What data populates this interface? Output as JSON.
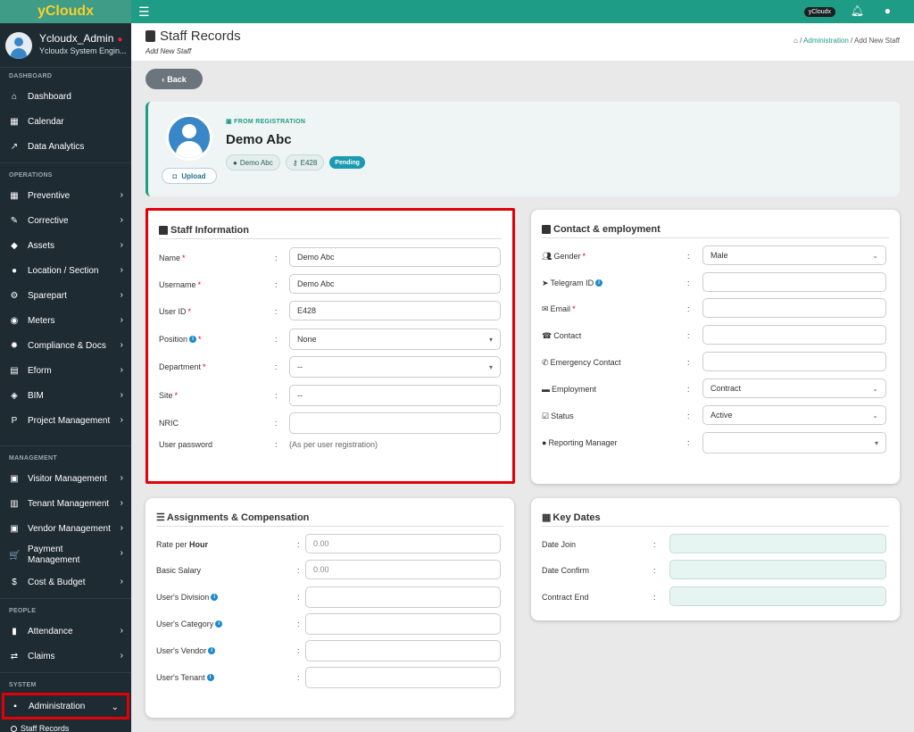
{
  "app": {
    "brand": "yCloudx"
  },
  "user": {
    "name": "Ycloudx_Admin",
    "role": "Ycloudx System Engin..."
  },
  "sidebar": {
    "sections": [
      "DASHBOARD",
      "OPERATIONS",
      "MANAGEMENT",
      "PEOPLE",
      "SYSTEM"
    ],
    "dashboard": [
      "Dashboard",
      "Calendar",
      "Data Analytics"
    ],
    "operations": [
      "Preventive",
      "Corrective",
      "Assets",
      "Location / Section",
      "Sparepart",
      "Meters",
      "Compliance & Docs",
      "Eform",
      "BIM",
      "Project Management"
    ],
    "management": [
      "Visitor Management",
      "Tenant Management",
      "Vendor Management",
      "Payment Management",
      "Cost & Budget"
    ],
    "people": [
      "Attendance",
      "Claims"
    ],
    "system": [
      "Administration"
    ],
    "sub": [
      "Staff Records"
    ]
  },
  "topbar": {
    "badge": "yCloudx"
  },
  "header": {
    "title": "Staff Records",
    "subtitle": "Add New Staff",
    "crumbs": [
      "Administration",
      "Add New Staff"
    ]
  },
  "back_label": "Back",
  "profile": {
    "source": "FROM REGISTRATION",
    "name": "Demo Abc",
    "chip_name": "Demo Abc",
    "chip_id": "E428",
    "status": "Pending",
    "upload": "Upload"
  },
  "staff_info": {
    "title": "Staff Information",
    "fields": [
      {
        "label": "Name",
        "value": "Demo Abc"
      },
      {
        "label": "Username",
        "value": "Demo Abc"
      },
      {
        "label": "User ID",
        "value": "E428"
      },
      {
        "label": "Position",
        "value": "None"
      },
      {
        "label": "Department",
        "value": "--"
      },
      {
        "label": "Site",
        "value": "--"
      },
      {
        "label": "NRIC",
        "value": ""
      },
      {
        "label": "User password",
        "value": "(As per user registration)"
      }
    ]
  },
  "contact": {
    "title": "Contact & employment",
    "fields": [
      {
        "label": "Gender",
        "value": "Male"
      },
      {
        "label": "Telegram ID",
        "value": ""
      },
      {
        "label": "Email",
        "value": ""
      },
      {
        "label": "Contact",
        "value": ""
      },
      {
        "label": "Emergency Contact",
        "value": ""
      },
      {
        "label": "Employment",
        "value": "Contract"
      },
      {
        "label": "Status",
        "value": "Active"
      },
      {
        "label": "Reporting Manager",
        "value": ""
      }
    ]
  },
  "assign": {
    "title": "Assignments & Compensation",
    "rate_prefix": "Rate per ",
    "rate_bold": "Hour",
    "fields": [
      {
        "label": "Basic Salary",
        "placeholder": "0.00"
      },
      {
        "label": "User's Division",
        "value": ""
      },
      {
        "label": "User's Category",
        "value": ""
      },
      {
        "label": "User's Vendor",
        "value": ""
      },
      {
        "label": "User's Tenant",
        "value": ""
      }
    ],
    "rate_placeholder": "0.00"
  },
  "keydates": {
    "title": "Key Dates",
    "fields": [
      {
        "label": "Date Join"
      },
      {
        "label": "Date Confirm"
      },
      {
        "label": "Contract End"
      }
    ]
  },
  "colon": ":"
}
